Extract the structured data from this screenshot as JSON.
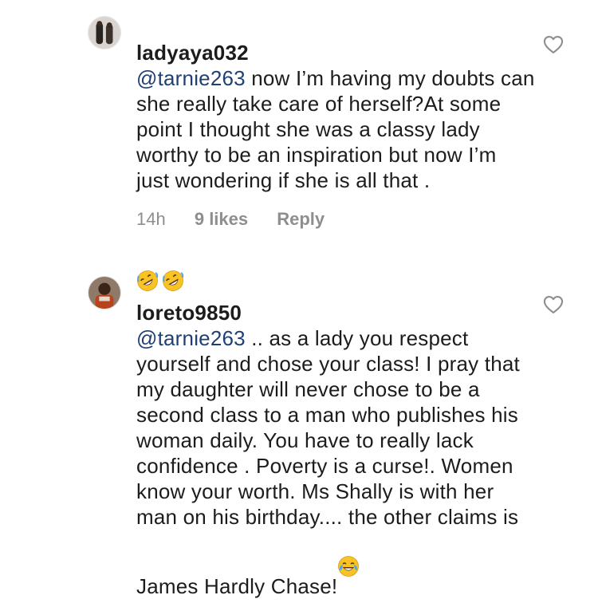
{
  "comments": [
    {
      "username": "ladyaya032",
      "mention": "@tarnie263",
      "text": " now I’m having my doubts can she really take care of herself?At some point I thought she was a classy lady worthy to be an inspiration  but now I’m just wondering if she is all that .",
      "emojis": [
        "rolling-on-floor-laughing-emoji",
        "rolling-on-floor-laughing-emoji"
      ],
      "time": "14h",
      "likes": "9 likes",
      "reply_label": "Reply",
      "avatar_icon": "user-avatar-icon"
    },
    {
      "username": "loreto9850",
      "mention": "@tarnie263",
      "text": " .. as a lady you respect yourself and chose your class!  I pray that my daughter will never chose to be a second class to a man who publishes his woman daily.  You have to really lack confidence . Poverty is a curse!. Women know your worth.  Ms Shally is with her man on his birthday.... the other claims is James Hardly Chase!",
      "emojis": [
        "tears-of-joy-emoji"
      ],
      "avatar_icon": "user-avatar-icon"
    }
  ],
  "colors": {
    "text": "#1c1c1c",
    "mention": "#1f3f75",
    "meta": "#8e8e8e",
    "heart_outline": "#8e8e8e"
  }
}
